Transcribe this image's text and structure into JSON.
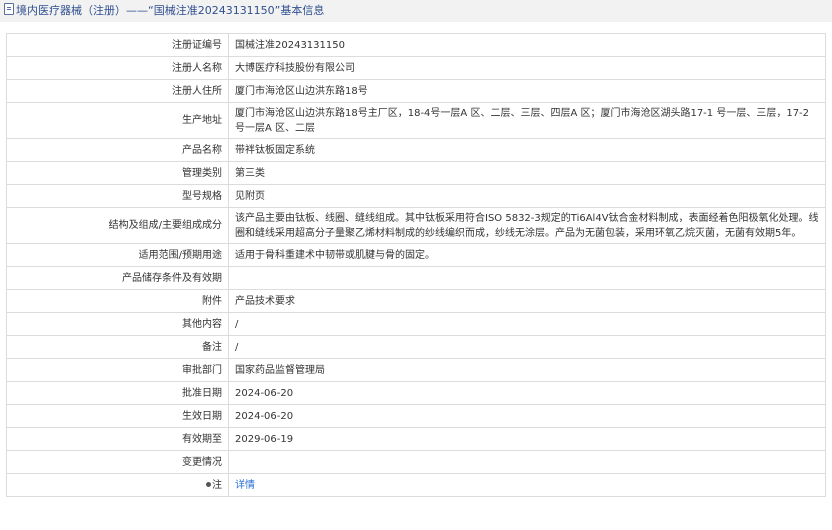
{
  "header": {
    "title": "境内医疗器械（注册）——“国械注准20243131150”基本信息"
  },
  "rows": [
    {
      "label": "注册证编号",
      "value": "国械注准20243131150"
    },
    {
      "label": "注册人名称",
      "value": "大博医疗科技股份有限公司"
    },
    {
      "label": "注册人住所",
      "value": "厦门市海沧区山边洪东路18号"
    },
    {
      "label": "生产地址",
      "value": "厦门市海沧区山边洪东路18号主厂区，18-4号一层A 区、二层、三层、四层A 区；厦门市海沧区湖头路17-1 号一层、三层，17-2号一层A 区、二层"
    },
    {
      "label": "产品名称",
      "value": "带袢钛板固定系统"
    },
    {
      "label": "管理类别",
      "value": "第三类"
    },
    {
      "label": "型号规格",
      "value": "见附页"
    },
    {
      "label": "结构及组成/主要组成成分",
      "value": "该产品主要由钛板、线圈、缝线组成。其中钛板采用符合ISO 5832-3规定的Ti6Al4V钛合金材料制成，表面经着色阳极氧化处理。线圈和缝线采用超高分子量聚乙烯材料制成的纱线编织而成，纱线无涂层。产品为无菌包装，采用环氧乙烷灭菌，无菌有效期5年。"
    },
    {
      "label": "适用范围/预期用途",
      "value": "适用于骨科重建术中韧带或肌腱与骨的固定。"
    },
    {
      "label": "产品储存条件及有效期",
      "value": ""
    },
    {
      "label": "附件",
      "value": "产品技术要求"
    },
    {
      "label": "其他内容",
      "value": "/"
    },
    {
      "label": "备注",
      "value": "/"
    },
    {
      "label": "审批部门",
      "value": "国家药品监督管理局"
    },
    {
      "label": "批准日期",
      "value": "2024-06-20"
    },
    {
      "label": "生效日期",
      "value": "2024-06-20"
    },
    {
      "label": "有效期至",
      "value": "2029-06-19"
    },
    {
      "label": "变更情况",
      "value": ""
    },
    {
      "label": "注",
      "value": "详情"
    }
  ]
}
